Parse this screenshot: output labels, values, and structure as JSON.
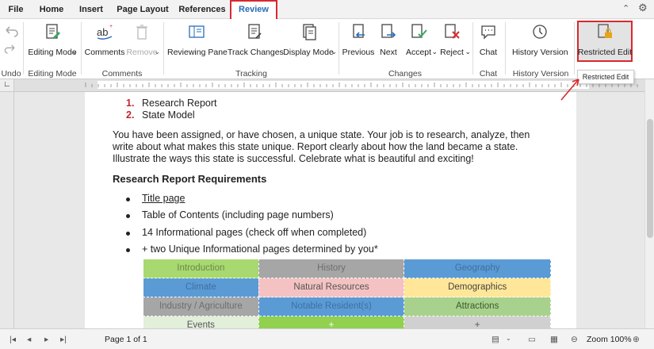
{
  "menu": {
    "items": [
      "File",
      "Home",
      "Insert",
      "Page Layout",
      "References",
      "Review"
    ],
    "active": "Review"
  },
  "ribbon": {
    "undo_group_label": "Undo",
    "editing_mode_label": "Editing Mode",
    "editing_group_label": "Editing Mode",
    "comments_label": "Comments",
    "remove_label": "Remove",
    "comments_group_label": "Comments",
    "reviewing_pane_label": "Reviewing Pane",
    "track_changes_label": "Track Changes",
    "display_mode_label": "Display Mode",
    "tracking_group_label": "Tracking",
    "previous_label": "Previous",
    "next_label": "Next",
    "accept_label": "Accept",
    "reject_label": "Reject",
    "changes_group_label": "Changes",
    "chat_label": "Chat",
    "chat_group_label": "Chat",
    "history_version_label": "History Version",
    "history_group_label": "History Version",
    "restricted_edit_label": "Restricted Edit",
    "tooltip": "Restricted Edit"
  },
  "document": {
    "numbered": [
      {
        "num": "1.",
        "text": "Research Report"
      },
      {
        "num": "2.",
        "text": "State Model"
      }
    ],
    "intro": "You have been assigned, or have chosen, a unique state. Your job is to research, analyze, then write about what makes this state unique. Report clearly about how the land became a state. Illustrate the ways this state is successful. Celebrate what is beautiful and exciting!",
    "heading": "Research Report Requirements",
    "bullets": [
      "Title page",
      "Table of Contents (including page numbers)",
      "14 Informational pages (check off when completed)",
      "+ two Unique Informational pages determined by you*"
    ],
    "table": [
      [
        {
          "t": "Introduction",
          "bg": "#a8d870",
          "c": "#6b8a4a"
        },
        {
          "t": "History",
          "bg": "#a6a6a6",
          "c": "#6e6e6e"
        },
        {
          "t": "Geography",
          "bg": "#5b9bd5",
          "c": "#3e70a0"
        }
      ],
      [
        {
          "t": "Climate",
          "bg": "#5b9bd5",
          "c": "#3e70a0"
        },
        {
          "t": "Natural Resources",
          "bg": "#f4c2c2",
          "c": "#555555"
        },
        {
          "t": "Demographics",
          "bg": "#ffe699",
          "c": "#444444"
        }
      ],
      [
        {
          "t": "Industry / Agriculture",
          "bg": "#a6a6a6",
          "c": "#6e6e6e"
        },
        {
          "t": "Notable Resident(s)",
          "bg": "#5b9bd5",
          "c": "#3e70a0"
        },
        {
          "t": "Attractions",
          "bg": "#a9d18e",
          "c": "#3a5a2a"
        }
      ],
      [
        {
          "t": "Events",
          "bg": "#e2efda",
          "c": "#555555"
        },
        {
          "t": "+",
          "bg": "#92d050",
          "c": "#ffffff"
        },
        {
          "t": "+",
          "bg": "#d0d0d0",
          "c": "#555555"
        }
      ]
    ]
  },
  "status": {
    "page": "Page 1 of 1",
    "zoom": "Zoom 100%"
  },
  "colors": {
    "accent": "#2a6db8",
    "highlight": "#d9282f"
  }
}
